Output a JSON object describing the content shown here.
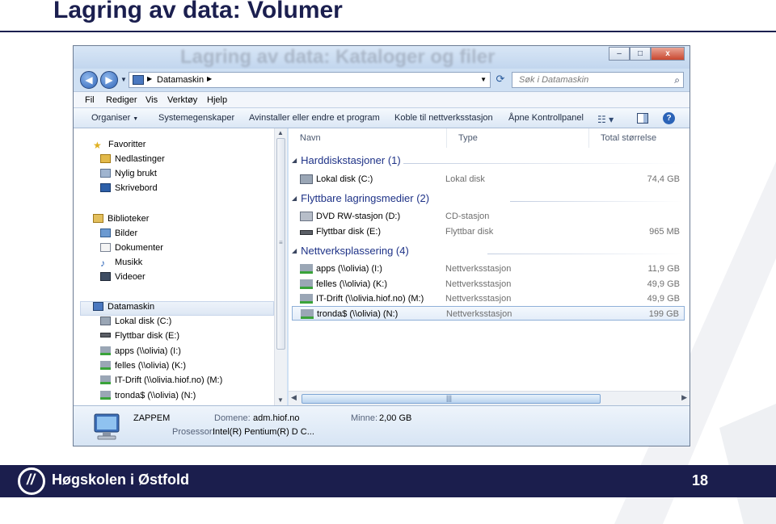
{
  "slide": {
    "title": "Lagring av data: Volumer",
    "page_number": "18",
    "brand": "Høgskolen i Østfold"
  },
  "window": {
    "ghost_title": "Lagring av data: Kataloger og filer",
    "buttons": {
      "minimize": "–",
      "maximize": "□",
      "close": "x"
    }
  },
  "address": {
    "path": "Datamaskin",
    "search_placeholder": "Søk i Datamaskin"
  },
  "menu": [
    "Fil",
    "Rediger",
    "Vis",
    "Verktøy",
    "Hjelp"
  ],
  "commands": {
    "organize": "Organiser",
    "system_props": "Systemegenskaper",
    "uninstall": "Avinstaller eller endre et program",
    "map_drive": "Koble til nettverksstasjon",
    "control_panel": "Åpne Kontrollpanel"
  },
  "nav": {
    "favorites": "Favoritter",
    "downloads": "Nedlastinger",
    "recent": "Nylig brukt",
    "desktop": "Skrivebord",
    "libraries": "Biblioteker",
    "pictures": "Bilder",
    "documents": "Dokumenter",
    "music": "Musikk",
    "videos": "Videoer",
    "computer": "Datamaskin",
    "drives": [
      "Lokal disk (C:)",
      "Flyttbar disk (E:)",
      "apps (\\\\olivia) (I:)",
      "felles (\\\\olivia) (K:)",
      "IT-Drift (\\\\olivia.hiof.no) (M:)",
      "tronda$ (\\\\olivia) (N:)"
    ]
  },
  "columns": {
    "name": "Navn",
    "type": "Type",
    "size": "Total størrelse"
  },
  "groups": {
    "hdd": {
      "title": "Harddiskstasjoner (1)",
      "rows": [
        {
          "name": "Lokal disk (C:)",
          "type": "Lokal disk",
          "size": "74,4 GB"
        }
      ]
    },
    "removable": {
      "title": "Flyttbare lagringsmedier (2)",
      "rows": [
        {
          "name": "DVD RW-stasjon (D:)",
          "type": "CD-stasjon",
          "size": ""
        },
        {
          "name": "Flyttbar disk (E:)",
          "type": "Flyttbar disk",
          "size": "965 MB"
        }
      ]
    },
    "network": {
      "title": "Nettverksplassering (4)",
      "rows": [
        {
          "name": "apps (\\\\olivia) (I:)",
          "type": "Nettverksstasjon",
          "size": "11,9 GB"
        },
        {
          "name": "felles (\\\\olivia) (K:)",
          "type": "Nettverksstasjon",
          "size": "49,9 GB"
        },
        {
          "name": "IT-Drift (\\\\olivia.hiof.no) (M:)",
          "type": "Nettverksstasjon",
          "size": "49,9 GB"
        },
        {
          "name": "tronda$ (\\\\olivia) (N:)",
          "type": "Nettverksstasjon",
          "size": "199 GB"
        }
      ]
    }
  },
  "details": {
    "computer_name": "ZAPPEM",
    "domain_label": "Domene:",
    "domain": "adm.hiof.no",
    "memory_label": "Minne:",
    "memory": "2,00 GB",
    "cpu_label": "Prosessor:",
    "cpu": "Intel(R) Pentium(R) D C..."
  },
  "colors": {
    "navy": "#1b1e4d",
    "group_blue": "#1e3287"
  }
}
